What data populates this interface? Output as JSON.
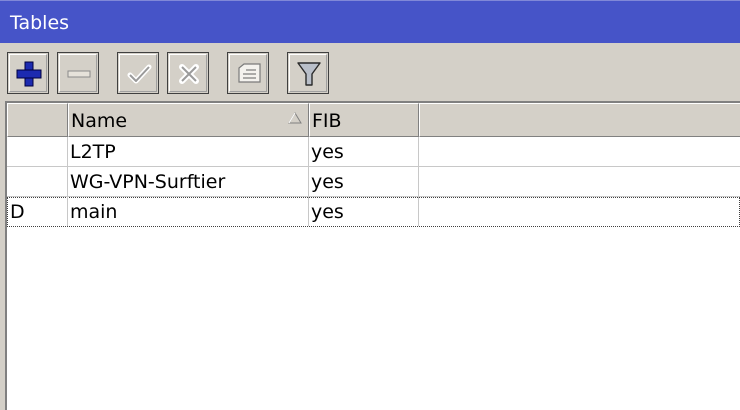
{
  "window": {
    "title": "Tables"
  },
  "toolbar": {
    "buttons": [
      {
        "name": "add",
        "icon": "plus-icon"
      },
      {
        "name": "remove",
        "icon": "minus-icon"
      },
      {
        "name": "enable",
        "icon": "check-icon"
      },
      {
        "name": "disable",
        "icon": "cross-icon"
      },
      {
        "name": "comment",
        "icon": "comment-icon"
      },
      {
        "name": "filter",
        "icon": "filter-icon"
      }
    ]
  },
  "table": {
    "columns": [
      "",
      "Name",
      "FIB"
    ],
    "sorted_column": "Name",
    "rows": [
      {
        "flag": "",
        "name": "L2TP",
        "fib": "yes"
      },
      {
        "flag": "",
        "name": "WG-VPN-Surftier",
        "fib": "yes"
      },
      {
        "flag": "D",
        "name": "main",
        "fib": "yes"
      }
    ]
  },
  "colors": {
    "titlebar": "#4654c8",
    "add_icon": "#1c2ab0"
  }
}
